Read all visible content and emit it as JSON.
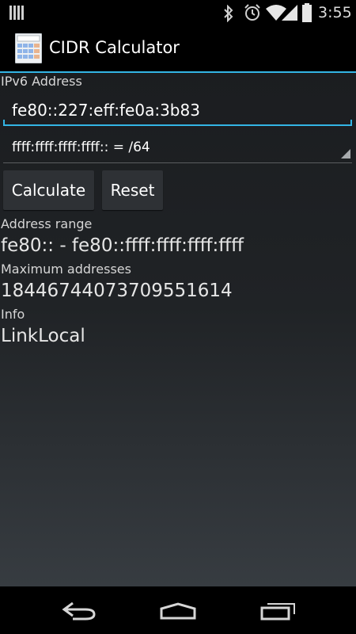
{
  "status_bar": {
    "time": "3:55",
    "icons": [
      "notification-icon",
      "bluetooth-icon",
      "alarm-icon",
      "wifi-icon",
      "signal-icon",
      "battery-icon"
    ]
  },
  "action_bar": {
    "title": "CIDR Calculator",
    "accent": "#33b5e5"
  },
  "form": {
    "ipv6_label": "IPv6 Address",
    "ipv6_value": "fe80::227:eff:fe0a:3b83",
    "mask_selected": "ffff:ffff:ffff:ffff:: = /64",
    "calculate_label": "Calculate",
    "reset_label": "Reset"
  },
  "results": {
    "range_label": "Address range",
    "range_value": "fe80:: - fe80::ffff:ffff:ffff:ffff",
    "max_label": "Maximum addresses",
    "max_value": "18446744073709551614",
    "info_label": "Info",
    "info_value": "LinkLocal"
  },
  "nav_bar": {
    "icons": [
      "back-icon",
      "home-icon",
      "recent-apps-icon"
    ]
  }
}
